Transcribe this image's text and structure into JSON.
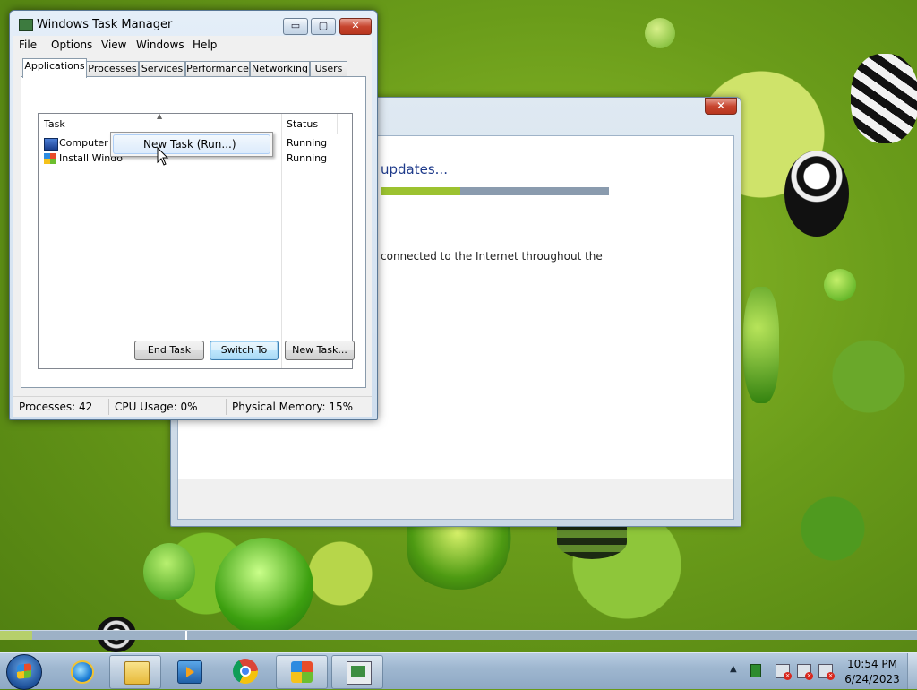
{
  "update_window": {
    "close_label": "✕",
    "title": "updates...",
    "progress_fraction": 0.35,
    "note": "connected to the Internet throughout the"
  },
  "task_manager": {
    "title": "Windows Task Manager",
    "caption_buttons": {
      "minimize": "▭",
      "maximize": "▢",
      "close": "✕"
    },
    "menu": [
      "File",
      "Options",
      "View",
      "Windows",
      "Help"
    ],
    "tabs": [
      "Applications",
      "Processes",
      "Services",
      "Performance",
      "Networking",
      "Users"
    ],
    "active_tab": "Applications",
    "columns": {
      "task": "Task",
      "status": "Status"
    },
    "rows": [
      {
        "name": "Computer",
        "status": "Running",
        "icon": "computer-icon"
      },
      {
        "name": "Install Windo",
        "status": "Running",
        "icon": "windows-install-icon"
      }
    ],
    "buttons": {
      "end_task": "End Task",
      "switch_to": "Switch To",
      "new_task": "New Task..."
    },
    "status_bar": {
      "processes": "Processes: 42",
      "cpu": "CPU Usage: 0%",
      "memory": "Physical Memory: 15%"
    }
  },
  "context_menu": {
    "items": [
      "New Task (Run...)"
    ]
  },
  "taskbar": {
    "pinned": [
      "start-orb",
      "internet-explorer-icon",
      "windows-explorer-icon",
      "media-player-icon",
      "chrome-icon",
      "windows-setup-icon",
      "task-manager-icon"
    ],
    "tray_arrow": "▲",
    "clock": {
      "time": "10:54 PM",
      "date": "6/24/2023"
    }
  }
}
